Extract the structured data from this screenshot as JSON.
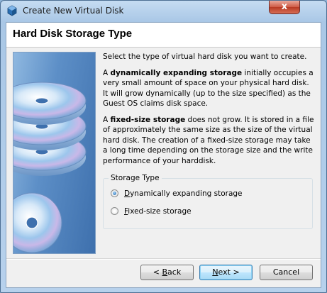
{
  "window": {
    "title": "Create New Virtual Disk",
    "close_glyph": "x"
  },
  "header": {
    "title": "Hard Disk Storage Type"
  },
  "side_image": {
    "icon": "stacked-discs-icon"
  },
  "content": {
    "intro": "Select the type of virtual hard disk you want to create.",
    "dynamic_prefix": "A ",
    "dynamic_bold": "dynamically expanding storage",
    "dynamic_rest": " initially occupies a very small amount of space on your physical hard disk. It will grow dynamically (up to the size specified) as the Guest OS claims disk space.",
    "fixed_prefix": "A ",
    "fixed_bold": "fixed-size storage",
    "fixed_rest": " does not grow. It is stored in a file of approximately the same size as the size of the virtual hard disk. The creation of a fixed-size storage may take a long time depending on the storage size and the write performance of your harddisk."
  },
  "storage_type": {
    "legend": "Storage Type",
    "options": [
      {
        "mnemonic": "D",
        "rest": "ynamically expanding storage",
        "selected": true
      },
      {
        "mnemonic": "F",
        "rest": "ixed-size storage",
        "selected": false
      }
    ]
  },
  "buttons": {
    "back_lead": "< ",
    "back_mnemonic": "B",
    "back_rest": "ack",
    "next_mnemonic": "N",
    "next_rest": "ext >",
    "cancel": "Cancel"
  },
  "colors": {
    "accent": "#3c7fb1",
    "panel": "#5d8fc7"
  }
}
